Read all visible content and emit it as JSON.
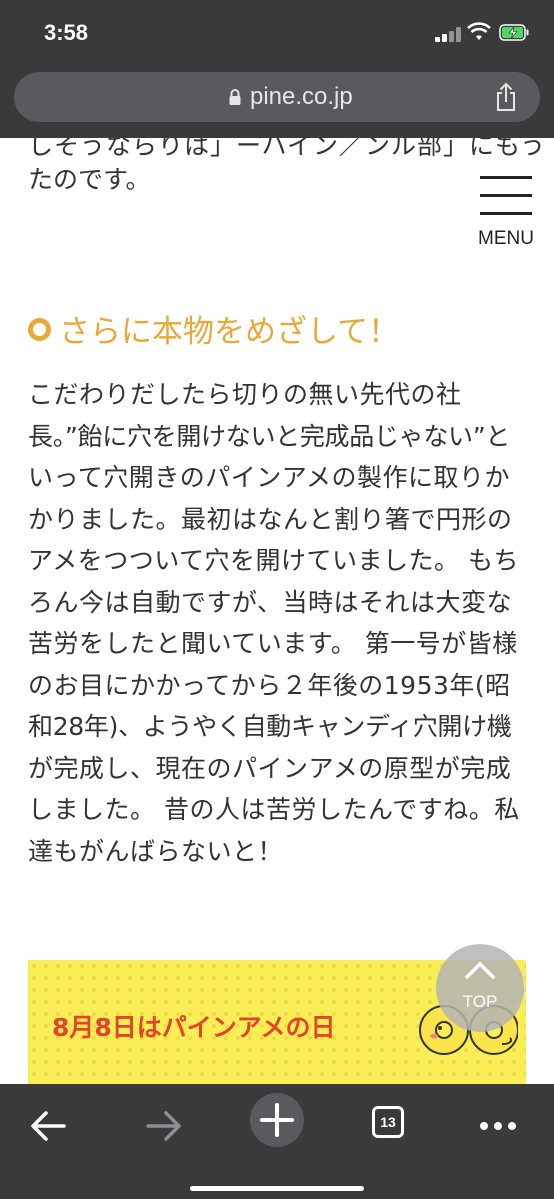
{
  "status_bar": {
    "time": "3:58"
  },
  "browser": {
    "url": "pine.co.jp"
  },
  "page": {
    "prev_text_clipped": "しそうならりは」ーハイン／ンル部」にもう",
    "prev_text_end": "たのです。",
    "menu_label": "MENU",
    "section_heading": "さらに本物をめざして！",
    "body_lines": [
      "こだわりだしたら切りの無い先代の社",
      "長。”飴に穴を開けないと完成品じゃない”と",
      "いって穴開きのパインアメの製作に取りか",
      "かりました。最初はなんと割り箸で円形の",
      "アメをつついて穴を開けていました。 もち",
      "ろん今は自動ですが、当時はそれは大変な",
      "苦労をしたと聞いています。 第一号が皆様",
      "のお目にかかってから２年後の1953年(昭",
      "和28年)、ようやく自動キャンディ穴開け機",
      "が完成し、現在のパインアメの原型が完成",
      "しました。 昔の人は苦労したんですね。私",
      "達もがんばらないと！"
    ],
    "banner_text": "8月8日はパインアメの日",
    "top_label": "TOP"
  },
  "toolbar": {
    "tab_count": "13"
  },
  "colors": {
    "accent": "#e8a93a",
    "banner_bg": "#f9ee55",
    "banner_text": "#e2452b",
    "chrome": "#3a3a3c"
  }
}
